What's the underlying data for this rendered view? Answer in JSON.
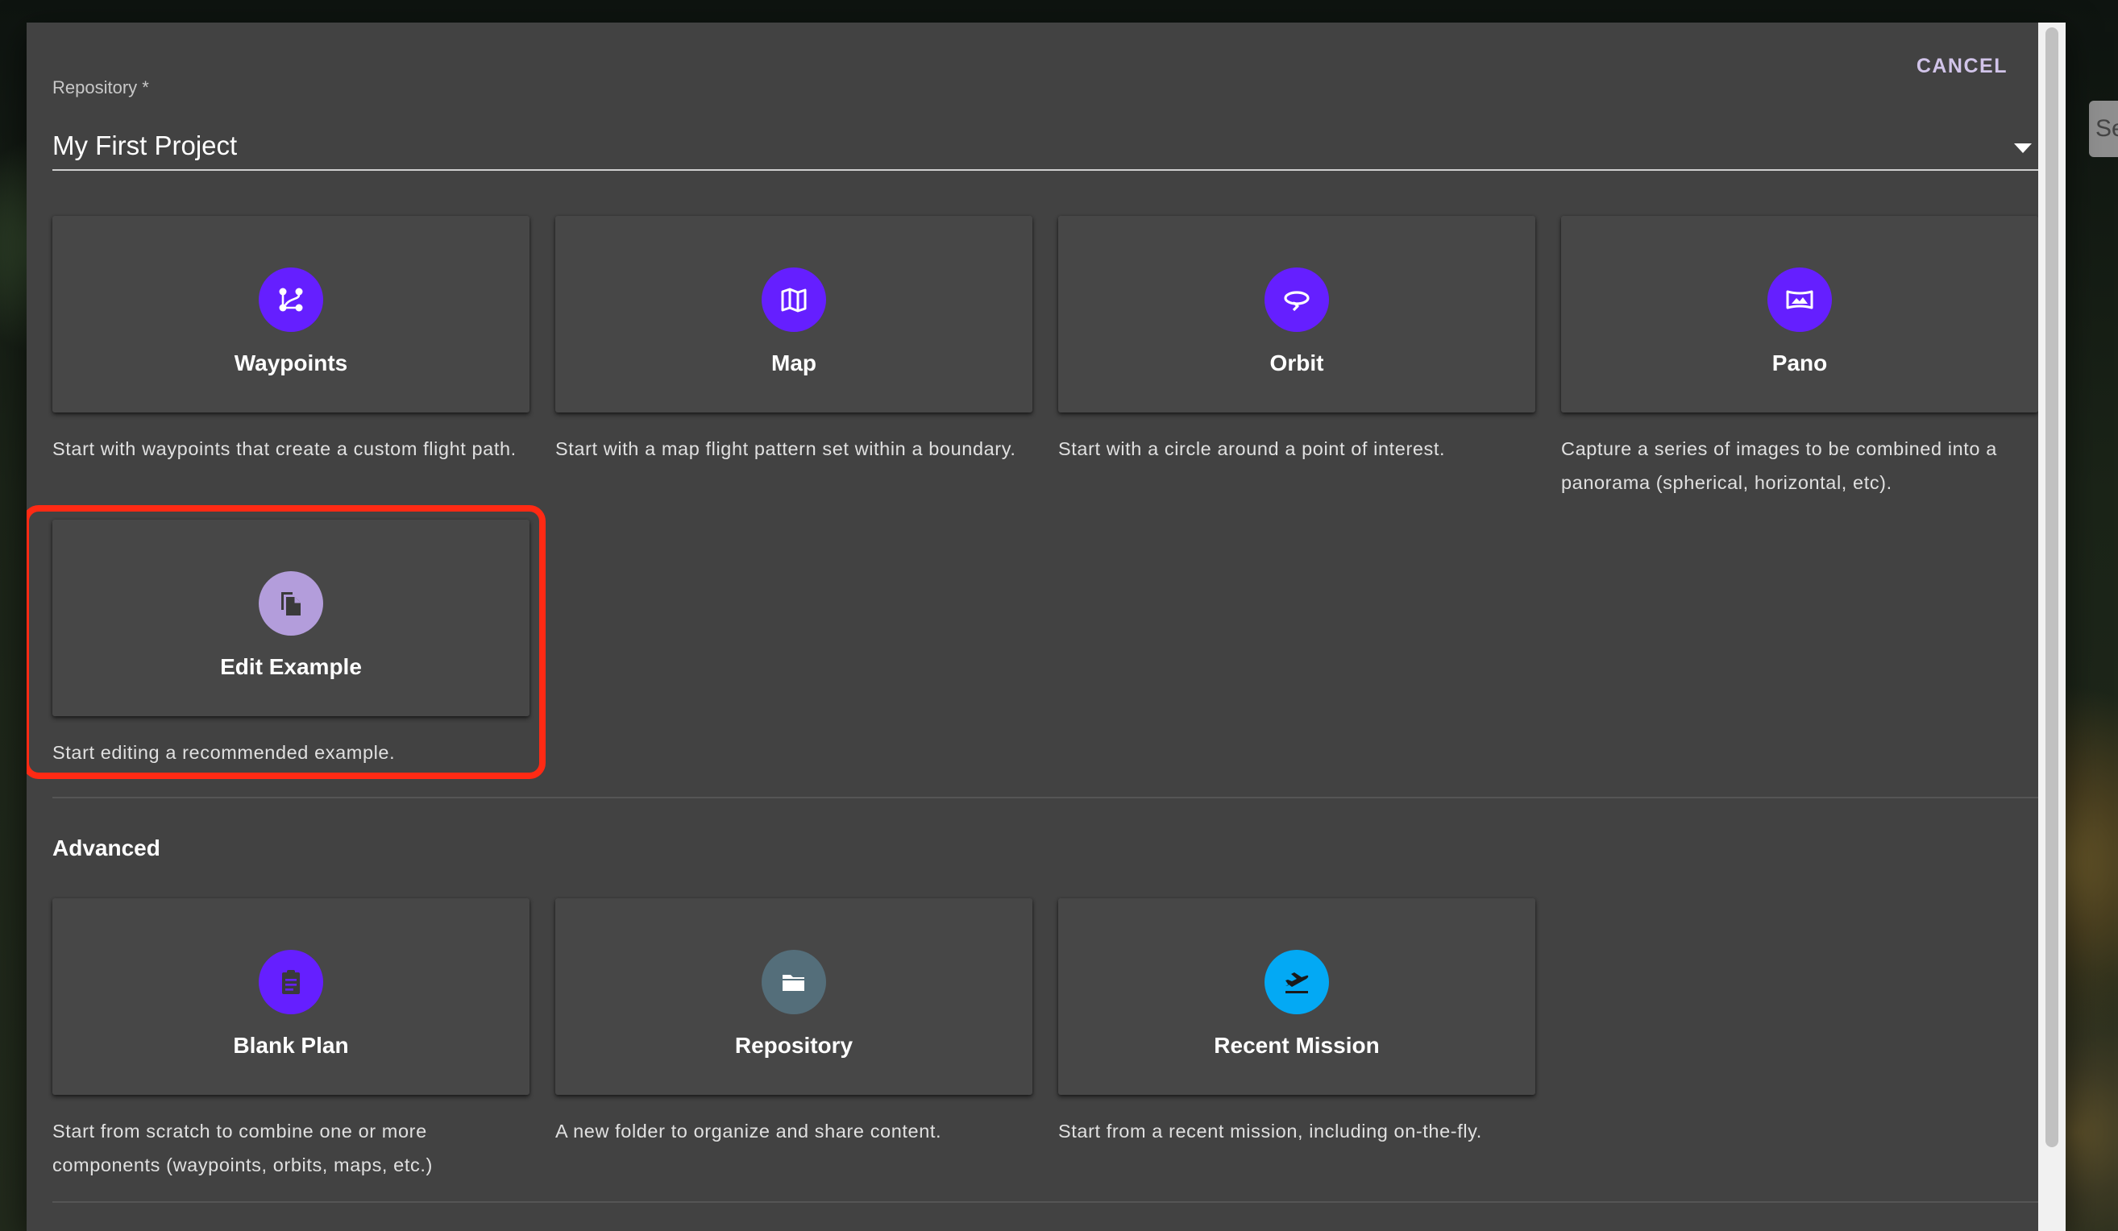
{
  "dialog": {
    "cancel_label": "CANCEL",
    "repository_label": "Repository *",
    "repository_value": "My First Project",
    "background_search_fragment": "Se"
  },
  "create_options": [
    {
      "title": "Waypoints",
      "description": "Start with waypoints that create a custom flight path.",
      "icon": "waypoints-icon",
      "color": "#651fff"
    },
    {
      "title": "Map",
      "description": "Start with a map flight pattern set within a boundary.",
      "icon": "map-icon",
      "color": "#651fff"
    },
    {
      "title": "Orbit",
      "description": "Start with a circle around a point of interest.",
      "icon": "orbit-icon",
      "color": "#651fff"
    },
    {
      "title": "Pano",
      "description": "Capture a series of images to be combined into a panorama (spherical, horizontal, etc).",
      "icon": "panorama-icon",
      "color": "#651fff"
    },
    {
      "title": "Edit Example",
      "description": "Start editing a recommended example.",
      "icon": "copy-document-icon",
      "color": "#b39ddb",
      "highlighted": true
    }
  ],
  "advanced": {
    "title": "Advanced",
    "options": [
      {
        "title": "Blank Plan",
        "description": "Start from scratch to combine one or more components (waypoints, orbits, maps, etc.)",
        "icon": "clipboard-icon",
        "color": "#651fff"
      },
      {
        "title": "Repository",
        "description": "A new folder to organize and share content.",
        "icon": "folder-icon",
        "color": "#546e7a"
      },
      {
        "title": "Recent Mission",
        "description": "Start from a recent mission, including on-the-fly.",
        "icon": "airplane-takeoff-icon",
        "color": "#03a9f4"
      }
    ]
  }
}
